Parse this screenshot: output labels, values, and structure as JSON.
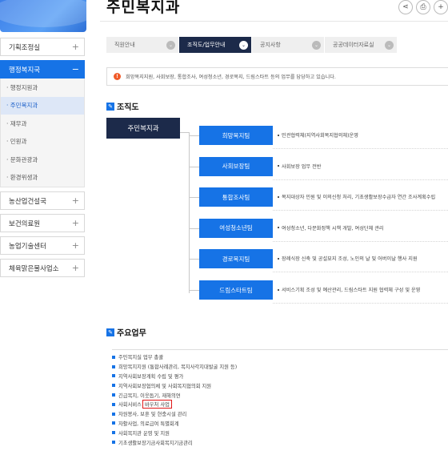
{
  "page": {
    "title": "주민복지과"
  },
  "header": {
    "tools": [
      {
        "name": "share-icon",
        "glyph": "⋖"
      },
      {
        "name": "print-icon",
        "glyph": "⎙"
      },
      {
        "name": "plus-icon",
        "glyph": "+"
      }
    ]
  },
  "sidebar": {
    "groups_top": [
      {
        "label": "기획조정실",
        "toggle": "+"
      }
    ],
    "active_group": {
      "label": "행정복지국",
      "toggle": "−"
    },
    "sub_items": [
      {
        "label": "· 행정지원과",
        "current": false
      },
      {
        "label": "· 주민복지과",
        "current": true
      },
      {
        "label": "· 재무과",
        "current": false
      },
      {
        "label": "· 민원과",
        "current": false
      },
      {
        "label": "· 문화관광과",
        "current": false
      },
      {
        "label": "· 환경위생과",
        "current": false
      }
    ],
    "groups_bottom": [
      {
        "label": "농산업건설국",
        "toggle": "+"
      },
      {
        "label": "보건의료원",
        "toggle": "+"
      },
      {
        "label": "농업기술센터",
        "toggle": "+"
      },
      {
        "label": "체육맑은물사업소",
        "toggle": "+"
      }
    ]
  },
  "tabs": [
    {
      "label": "직원안내",
      "active": false
    },
    {
      "label": "조직도/업무안내",
      "active": true
    },
    {
      "label": "공지사항",
      "active": false
    },
    {
      "label": "공공데이터자료실",
      "active": false
    }
  ],
  "notice": {
    "text": "희망복지지원, 사회보장, 통합조사, 여성청소년, 경로복지, 드림스타트 등의 업무를 담당하고 있습니다."
  },
  "org_section": {
    "title": "조직도"
  },
  "org_chart": {
    "root": "주민복지과",
    "units": [
      {
        "name": "희망복지팀",
        "desc": "민관협력체(지역사회복지협의체)운영"
      },
      {
        "name": "사회보장팀",
        "desc": "사회보장 업무 전반"
      },
      {
        "name": "통합조사팀",
        "desc": "복지대상자 민원 및 이의신청 처리, 기초생활보장수급자 연간 조사계획수립"
      },
      {
        "name": "여성청소년팀",
        "desc": "여성청소년, 다문화정책 시책 개발, 여성단체 관리"
      },
      {
        "name": "경로복지팀",
        "desc": "장례식장 신축 및 공설묘지 조성, 노인의 날 및 어버이날 행사 지원"
      },
      {
        "name": "드림스타트팀",
        "desc": "서비스기획 조성 및 예산관리, 드림스타트 지원 협력체 구성 및 운영"
      }
    ]
  },
  "tasks_section": {
    "title": "주요업무"
  },
  "tasks": [
    {
      "text": "주민복지실 업무 총괄"
    },
    {
      "text": "희망복지지원 (통합사례관리, 복지사각지대발굴 지원 등)"
    },
    {
      "text": "지역사회보장계획 수립 및 평가"
    },
    {
      "text": "지역사회보장협의체 및 사회복지협의회 지원"
    },
    {
      "text": "긴급복지, 이웃돕기, 재해의연"
    },
    {
      "text": "사회서비스",
      "highlight": "바우처 사업"
    },
    {
      "text": "자원봉사, 보훈 및 현충시설 관리"
    },
    {
      "text": "자활사업, 의료급여 특별회계"
    },
    {
      "text": "사회복지관 운영 및 지원"
    },
    {
      "text": "기초생활보장기금사회복지기금관리"
    }
  ],
  "colors": {
    "primary": "#1673e6",
    "navy": "#1c2a4a",
    "alert": "#f05a28",
    "highlight": "#e01818"
  }
}
